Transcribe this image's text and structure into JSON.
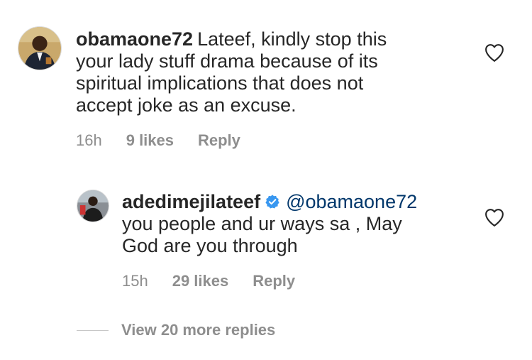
{
  "comments": [
    {
      "username": "obamaone72",
      "text": "Lateef, kindly stop this your lady stuff drama because of its spiritual implications that does not accept joke as an excuse.",
      "time": "16h",
      "likes": "9 likes",
      "reply": "Reply"
    },
    {
      "username": "adedimejilateef",
      "mention": "@obamaone72",
      "text": "you people and ur ways sa , May God are you through",
      "time": "15h",
      "likes": "29 likes",
      "reply": "Reply"
    }
  ],
  "view_more": "View 20 more replies",
  "colors": {
    "text": "#262626",
    "muted": "#8e8e8e",
    "mention": "#00376b",
    "verified": "#3897f0"
  },
  "icons": {
    "like": "heart-outline-icon",
    "verified": "verified-badge-icon"
  }
}
